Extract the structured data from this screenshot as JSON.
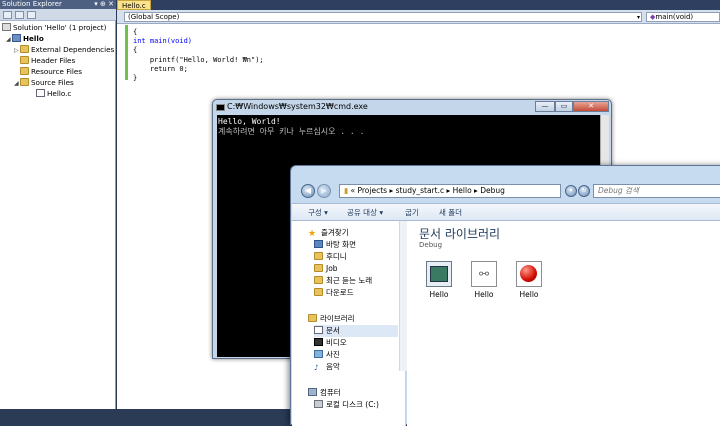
{
  "solution_explorer": {
    "title": "Solution Explorer",
    "pin_glyphs": "▾ ⊕ ✕",
    "tree": [
      {
        "label": "Solution 'Hello' (1 project)",
        "kind": "solution"
      },
      {
        "label": "Hello",
        "kind": "project"
      },
      {
        "label": "External Dependencies",
        "kind": "folder"
      },
      {
        "label": "Header Files",
        "kind": "folder"
      },
      {
        "label": "Resource Files",
        "kind": "folder"
      },
      {
        "label": "Source Files",
        "kind": "folder"
      },
      {
        "label": "Hello.c",
        "kind": "file"
      }
    ]
  },
  "editor": {
    "tab_label": "Hello.c",
    "scope_combo": "(Global Scope)",
    "function_combo": "main(void)",
    "code_lines": [
      "{",
      "int main(void)",
      "{",
      "    printf(\"Hello, World! ₩n\");",
      "    return 0;",
      "}"
    ]
  },
  "cmd_window": {
    "title": "C:₩Windows₩system32₩cmd.exe",
    "output_line1": "Hello, World!",
    "output_line2": "계속하려면 아무 키나 누르십시오 . . ."
  },
  "explorer": {
    "address_path": "« Projects ▸ study_start.c ▸ Hello ▸ Debug",
    "search_placeholder": "Debug 검색",
    "commands": [
      "구성 ▾",
      "공유 대상 ▾",
      "굽기",
      "새 폴더"
    ],
    "nav": {
      "favorites_header": "즐겨찾기",
      "favorites": [
        "바탕 화면",
        "후디니",
        "Job",
        "최근 듣는 노래",
        "다운로드"
      ],
      "libraries_header": "라이브러리",
      "libraries": [
        "문서",
        "비디오",
        "사진",
        "음악"
      ],
      "computer_header": "컴퓨터",
      "computer": [
        "로컬 디스크 (C:)"
      ]
    },
    "content_title": "문서 라이브러리",
    "content_subtitle": "Debug",
    "files": [
      {
        "label": "Hello",
        "icon": "exe-window-icon"
      },
      {
        "label": "Hello",
        "icon": "chain-file-icon"
      },
      {
        "label": "Hello",
        "icon": "red-ball-file-icon"
      }
    ]
  },
  "colors": {
    "accent_tab": "#fbe38d",
    "console_bg": "#000000",
    "console_text": "#c0c0c0"
  }
}
